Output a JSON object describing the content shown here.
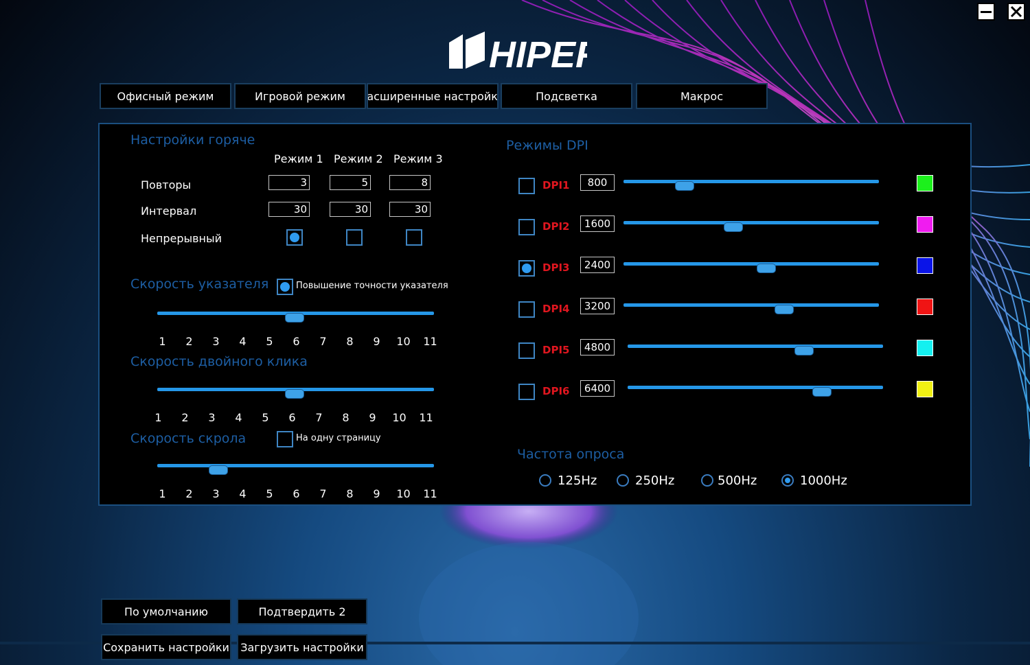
{
  "window": {
    "minimize_icon": "minimize-icon",
    "close_icon": "close-icon"
  },
  "brand": {
    "logo_text": "HIPER"
  },
  "tabs": [
    {
      "label": "Офисный режим"
    },
    {
      "label": "Игровой режим"
    },
    {
      "label": "Расширенные настройки"
    },
    {
      "label": "Подсветка"
    },
    {
      "label": "Макрос"
    }
  ],
  "hotkeys": {
    "title": "Настройки горяче",
    "modes": [
      "Режим 1",
      "Режим 2",
      "Режим 3"
    ],
    "rows": {
      "repeat_label": "Повторы",
      "interval_label": "Интервал",
      "continuous_label": "Непрерывный"
    },
    "repeat_values": [
      "3",
      "5",
      "8"
    ],
    "interval_values": [
      "30",
      "30",
      "30"
    ],
    "continuous_checked": [
      true,
      false,
      false
    ]
  },
  "pointer_speed": {
    "title": "Скорость указателя",
    "precision_label": "Повышение точности указателя",
    "precision_checked": true,
    "value": 6,
    "ticks": [
      "1",
      "2",
      "3",
      "4",
      "5",
      "6",
      "7",
      "8",
      "9",
      "10",
      "11"
    ]
  },
  "double_click": {
    "title": "Скорость двойного клика",
    "value": 6,
    "ticks": [
      "1",
      "2",
      "3",
      "4",
      "5",
      "6",
      "7",
      "8",
      "9",
      "10",
      "11"
    ]
  },
  "scroll_speed": {
    "title": "Скорость скрола",
    "one_page_label": "На одну страницу",
    "one_page_checked": false,
    "value": 3,
    "ticks": [
      "1",
      "2",
      "3",
      "4",
      "5",
      "6",
      "7",
      "8",
      "9",
      "10",
      "11"
    ]
  },
  "dpi": {
    "title": "Режимы DPI",
    "modes": [
      {
        "label": "DPI1",
        "value": "800",
        "selected": false,
        "color": "#1cf01c",
        "level": 0.24
      },
      {
        "label": "DPI2",
        "value": "1600",
        "selected": false,
        "color": "#f01cf0",
        "level": 0.43
      },
      {
        "label": "DPI3",
        "value": "2400",
        "selected": true,
        "color": "#0a14e8",
        "level": 0.56
      },
      {
        "label": "DPI4",
        "value": "3200",
        "selected": false,
        "color": "#f01414",
        "level": 0.63
      },
      {
        "label": "DPI5",
        "value": "4800",
        "selected": false,
        "color": "#14f0f0",
        "level": 0.69
      },
      {
        "label": "DPI6",
        "value": "6400",
        "selected": false,
        "color": "#f0f014",
        "level": 0.76
      }
    ]
  },
  "polling": {
    "title": "Частота опроса",
    "options": [
      {
        "label": "125Hz",
        "selected": false
      },
      {
        "label": "250Hz",
        "selected": false
      },
      {
        "label": "500Hz",
        "selected": false
      },
      {
        "label": "1000Hz",
        "selected": true
      }
    ]
  },
  "buttons": {
    "default": "По умолчанию",
    "confirm": "Подтвердить 2",
    "save": "Сохранить настройки",
    "load": "Загрузить настройки"
  }
}
